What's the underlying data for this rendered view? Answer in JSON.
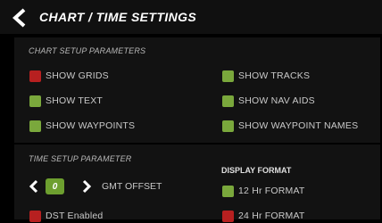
{
  "header": {
    "title": "CHART / TIME SETTINGS"
  },
  "chart_setup": {
    "label": "CHART SETUP PARAMETERS",
    "options": {
      "show_grids": {
        "label": "SHOW GRIDS",
        "enabled": false
      },
      "show_text": {
        "label": "SHOW TEXT",
        "enabled": true
      },
      "show_waypoints": {
        "label": "SHOW WAYPOINTS",
        "enabled": true
      },
      "show_tracks": {
        "label": "SHOW TRACKS",
        "enabled": true
      },
      "show_nav_aids": {
        "label": "SHOW NAV AIDS",
        "enabled": true
      },
      "show_waypoint_names": {
        "label": "SHOW WAYPOINT NAMES",
        "enabled": true
      }
    }
  },
  "time_setup": {
    "label": "TIME SETUP PARAMETER",
    "gmt_offset": {
      "value": "0",
      "label": "GMT OFFSET"
    },
    "dst": {
      "label": "DST Enabled",
      "enabled": false
    },
    "display_format": {
      "label": "DISPLAY FORMAT",
      "hr12": {
        "label": "12 Hr FORMAT",
        "enabled": true
      },
      "hr24": {
        "label": "24 Hr FORMAT",
        "enabled": false
      }
    }
  },
  "colors": {
    "on": "#7aa83c",
    "off": "#b72020",
    "background": "#000000"
  }
}
